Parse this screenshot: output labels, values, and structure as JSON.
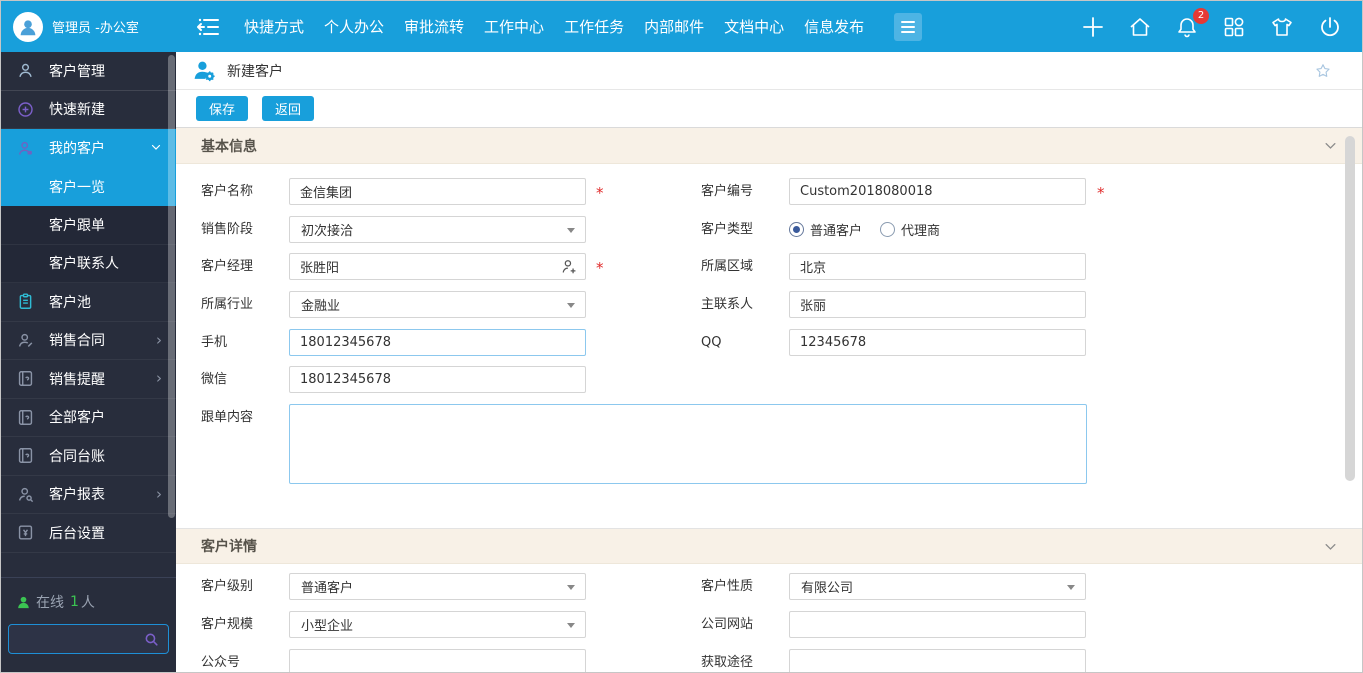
{
  "topbar": {
    "user_name": "管理员 -办公室",
    "nav": [
      "快捷方式",
      "个人办公",
      "审批流转",
      "工作中心",
      "工作任务",
      "内部邮件",
      "文档中心",
      "信息发布"
    ],
    "badge_count": "2",
    "icons": [
      "plus-icon",
      "home-icon",
      "bell-icon",
      "apps-grid-icon",
      "tshirt-icon",
      "power-icon"
    ],
    "colors": {
      "bar": "#189fdb",
      "menu_button": "#4db4e4",
      "badge": "#e53935"
    }
  },
  "sidebar": {
    "items": [
      {
        "label": "客户管理",
        "icon": "person-icon"
      },
      {
        "label": "快速新建",
        "icon": "plus-circle-icon"
      },
      {
        "label": "我的客户",
        "icon": "person-badge-icon",
        "expanded": true,
        "active": true
      },
      {
        "label": "客户一览",
        "submenu": true,
        "active": true
      },
      {
        "label": "客户跟单",
        "submenu": true
      },
      {
        "label": "客户联系人",
        "submenu": true
      },
      {
        "label": "客户池",
        "icon": "clipboard-icon"
      },
      {
        "label": "销售合同",
        "icon": "person-contract-icon",
        "expandable": true
      },
      {
        "label": "销售提醒",
        "icon": "phonebook-icon",
        "expandable": true
      },
      {
        "label": "全部客户",
        "icon": "phonebook-icon"
      },
      {
        "label": "合同台账",
        "icon": "phonebook-icon"
      },
      {
        "label": "客户报表",
        "icon": "person-report-icon",
        "expandable": true
      },
      {
        "label": "后台设置",
        "icon": "yen-book-icon"
      }
    ],
    "chevron_expanded": "⌄",
    "chevron_collapsed": "›",
    "online_label": "在线",
    "online_count": "1",
    "online_unit": "人",
    "colors": {
      "background": "#282d3c",
      "active": "#189fdb",
      "online_green": "#3bc452"
    }
  },
  "page": {
    "title": "新建客户",
    "save_label": "保存",
    "back_label": "返回"
  },
  "form": {
    "required_marker": "*",
    "section1_title": "基本信息",
    "section2_title": "客户详情",
    "fields": {
      "customer_name": {
        "label": "客户名称",
        "value": "金信集团",
        "required": true
      },
      "customer_code": {
        "label": "客户编号",
        "value": "Custom2018080018",
        "required": true
      },
      "sales_stage": {
        "label": "销售阶段",
        "value": "初次接洽",
        "type": "select"
      },
      "customer_type": {
        "label": "客户类型",
        "options": [
          "普通客户",
          "代理商"
        ],
        "selected": "普通客户",
        "type": "radio"
      },
      "account_manager": {
        "label": "客户经理",
        "value": "张胜阳",
        "required": true
      },
      "region": {
        "label": "所属区域",
        "value": "北京"
      },
      "industry": {
        "label": "所属行业",
        "value": "金融业",
        "type": "select"
      },
      "main_contact": {
        "label": "主联系人",
        "value": "张丽"
      },
      "mobile": {
        "label": "手机",
        "value": "18012345678"
      },
      "qq": {
        "label": "QQ",
        "value": "12345678"
      },
      "wechat": {
        "label": "微信",
        "value": "18012345678"
      },
      "follow_content": {
        "label": "跟单内容",
        "value": "",
        "type": "textarea"
      },
      "customer_level": {
        "label": "客户级别",
        "value": "普通客户",
        "type": "select"
      },
      "customer_nature": {
        "label": "客户性质",
        "value": "有限公司",
        "type": "select"
      },
      "customer_scale": {
        "label": "客户规模",
        "value": "小型企业",
        "type": "select"
      },
      "company_website": {
        "label": "公司网站",
        "value": ""
      },
      "public_account": {
        "label": "公众号",
        "value": ""
      },
      "acquisition": {
        "label": "获取途径",
        "value": ""
      }
    }
  }
}
